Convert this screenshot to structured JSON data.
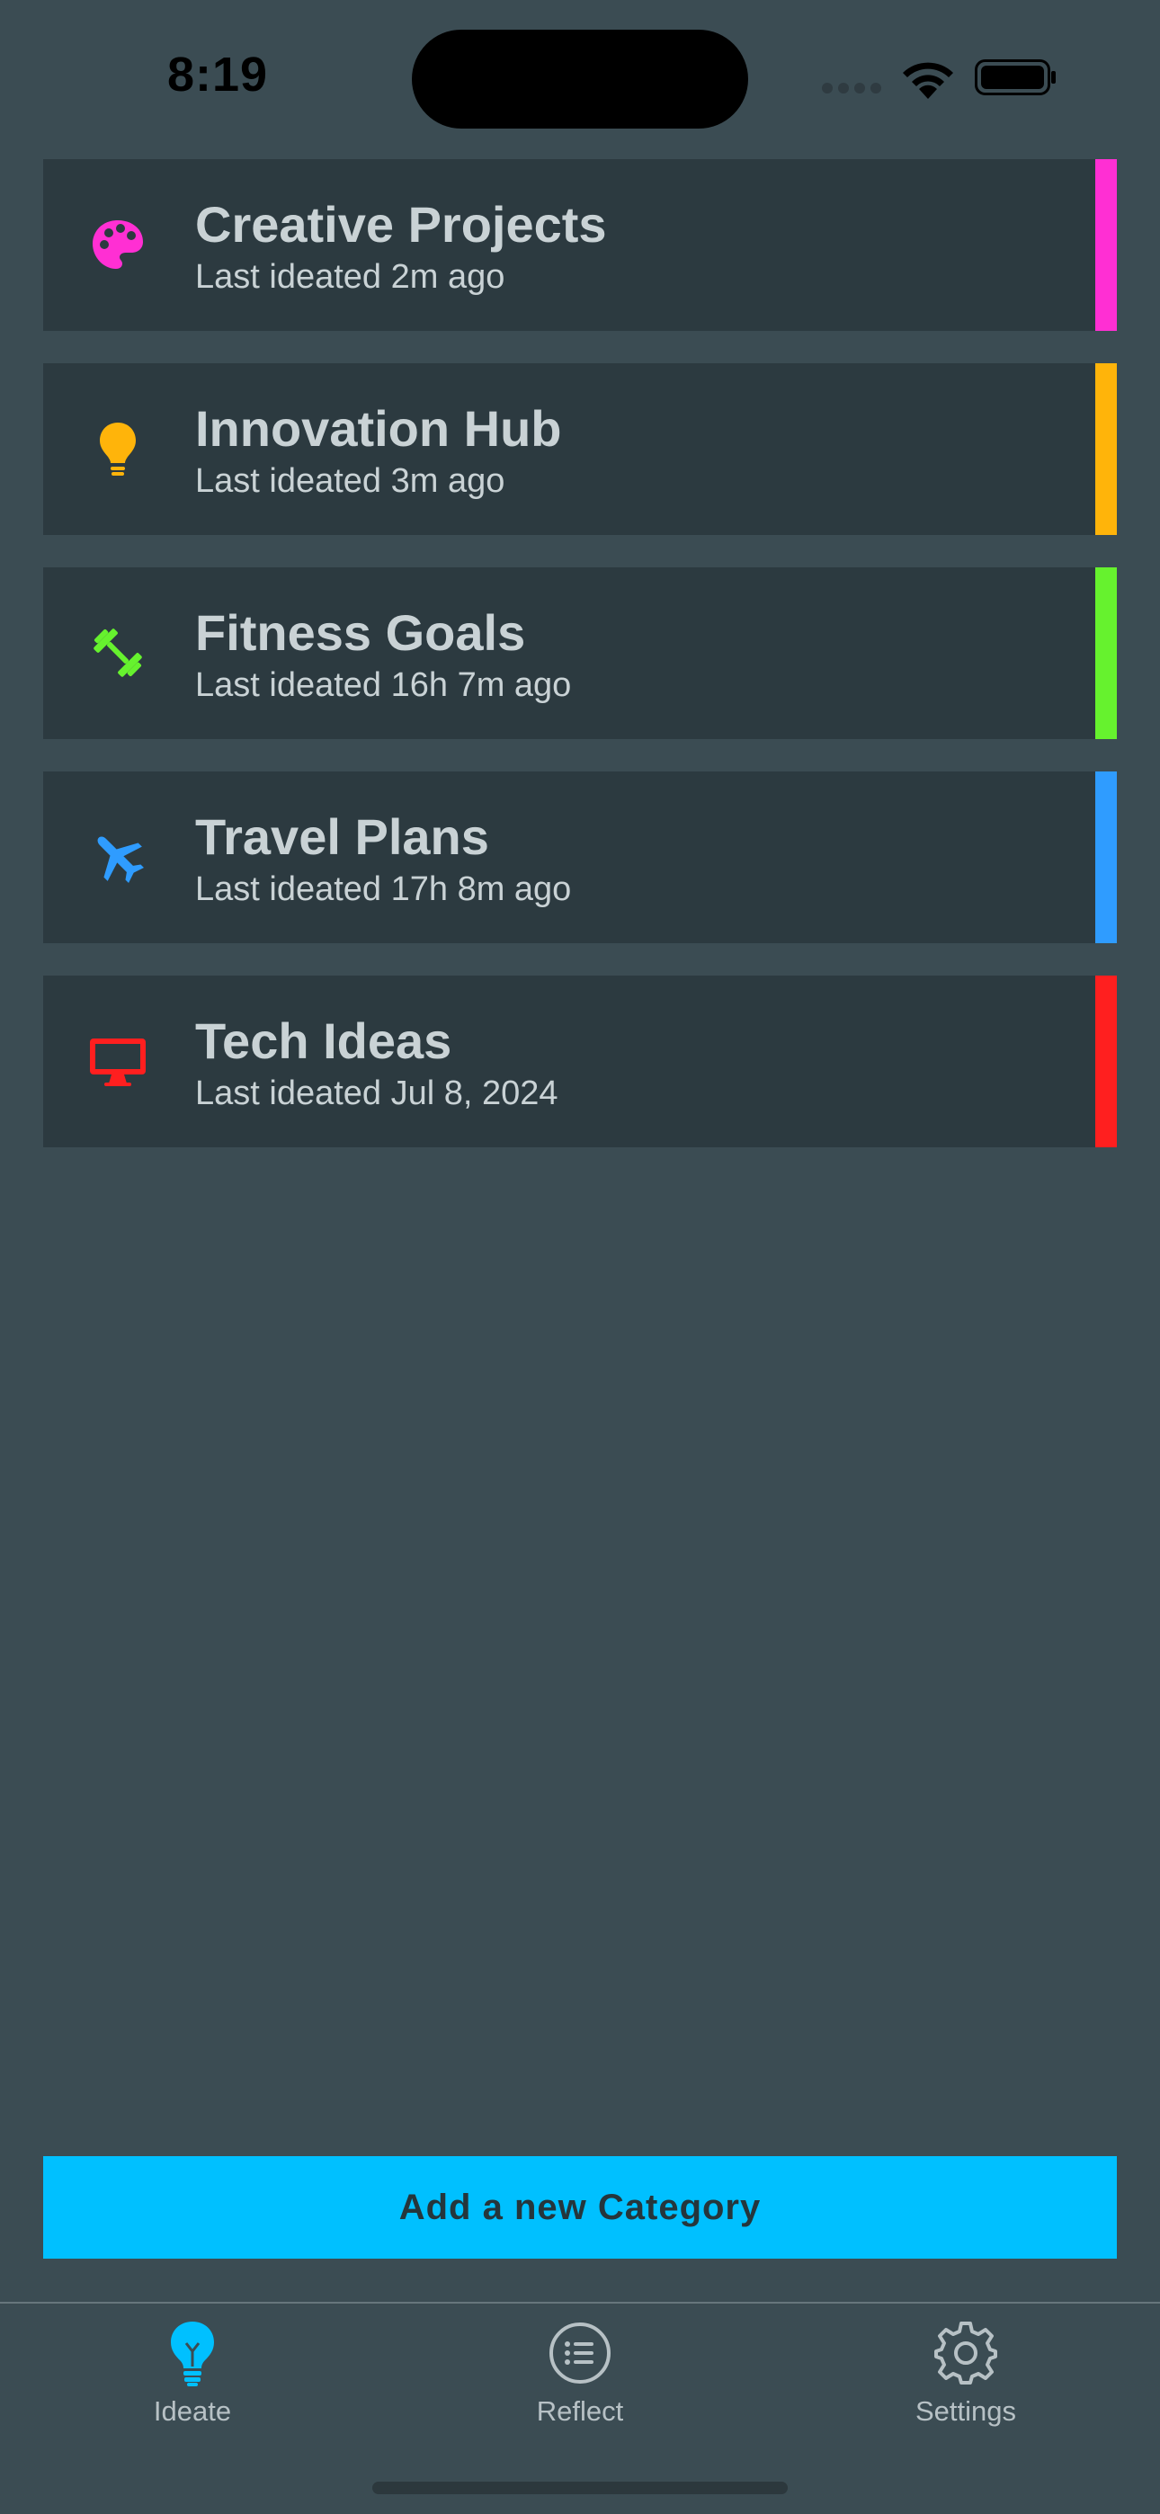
{
  "status_bar": {
    "time": "8:19"
  },
  "categories": [
    {
      "icon": "palette-icon",
      "title": "Creative Projects",
      "subtitle": "Last ideated 2m ago",
      "color": "#ff2fd3"
    },
    {
      "icon": "lightbulb-icon",
      "title": "Innovation Hub",
      "subtitle": "Last ideated 3m ago",
      "color": "#ffb40a"
    },
    {
      "icon": "dumbbell-icon",
      "title": "Fitness Goals",
      "subtitle": "Last ideated 16h 7m ago",
      "color": "#66f22e"
    },
    {
      "icon": "airplane-icon",
      "title": "Travel Plans",
      "subtitle": "Last ideated 17h 8m ago",
      "color": "#2f9cff"
    },
    {
      "icon": "desktop-icon",
      "title": "Tech Ideas",
      "subtitle": "Last ideated Jul 8, 2024",
      "color": "#ff1f1f"
    }
  ],
  "add_button": {
    "label": "Add a new Category",
    "color": "#00c0ff"
  },
  "tab_bar": {
    "tabs": [
      {
        "label": "Ideate",
        "icon": "lightbulb-icon",
        "active": true,
        "color": "#00c0ff"
      },
      {
        "label": "Reflect",
        "icon": "list-icon",
        "active": false,
        "color": "#b7c1c5"
      },
      {
        "label": "Settings",
        "icon": "gear-icon",
        "active": false,
        "color": "#b7c1c5"
      }
    ]
  }
}
